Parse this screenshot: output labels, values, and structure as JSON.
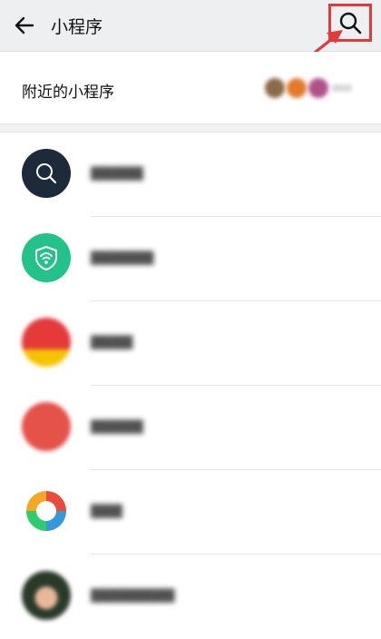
{
  "header": {
    "title": "小程序",
    "back_icon": "arrow-left-icon",
    "search_icon": "search-icon"
  },
  "nearby": {
    "label": "附近的小程序",
    "thumb_colors": [
      "#8a6a4a",
      "#e27a2a",
      "#b0508a"
    ]
  },
  "apps": [
    {
      "name": "",
      "icon": "search-icon",
      "color": "#1c2a3a"
    },
    {
      "name": "",
      "icon": "wifi-shield-icon",
      "color": "#22c28a"
    },
    {
      "name": "",
      "icon": "app-logo",
      "color": "#e43a3a"
    },
    {
      "name": "",
      "icon": "app-logo",
      "color": "#e4524a"
    },
    {
      "name": "",
      "icon": "camera-aperture-icon",
      "color": "#ffffff"
    },
    {
      "name": "",
      "icon": "avatar",
      "color": "#3a5a3a"
    }
  ],
  "colors": {
    "annotation": "#e23a3a",
    "header_bg": "#eeeff1"
  }
}
